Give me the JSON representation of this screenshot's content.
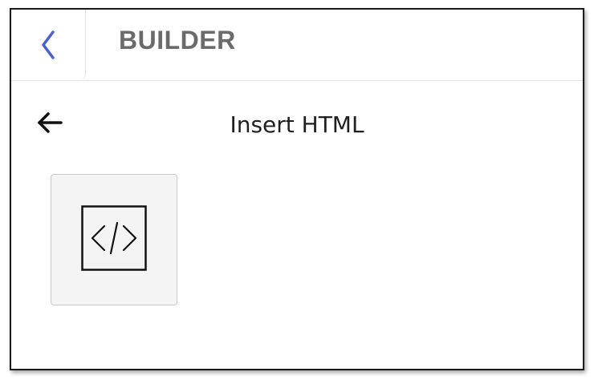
{
  "header": {
    "title": "BUILDER",
    "back_icon": "chevron-left-icon",
    "accent_color": "#4a5fd1"
  },
  "panel": {
    "title": "Insert HTML",
    "back_icon": "arrow-left-icon"
  },
  "tiles": [
    {
      "icon": "code-icon"
    }
  ]
}
